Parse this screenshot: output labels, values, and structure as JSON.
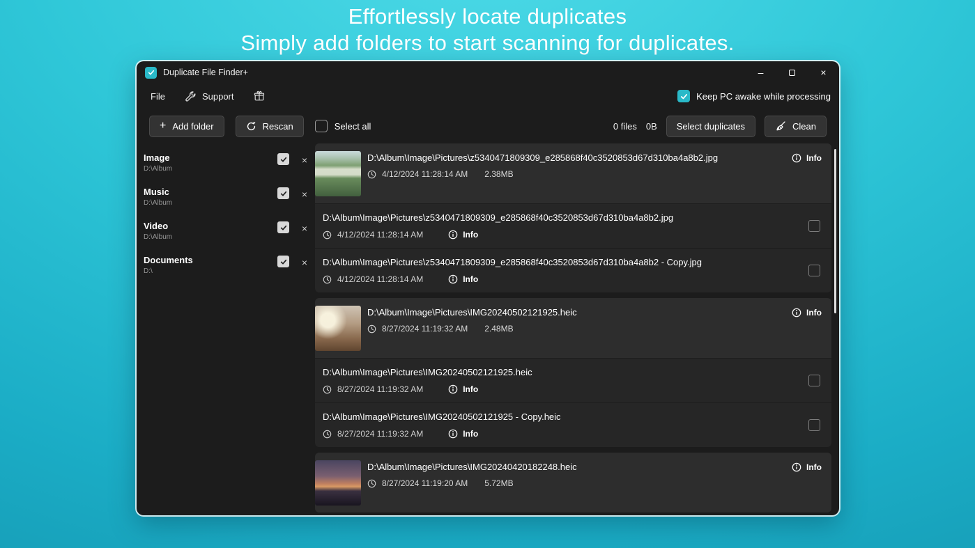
{
  "hero": {
    "title": "Effortlessly locate duplicates",
    "subtitle": "Simply add folders to start scanning for duplicates."
  },
  "icons": {
    "minimize": "–",
    "close": "×",
    "remove": "×",
    "plus": "+"
  },
  "colors": {
    "accent": "#2ab9c8",
    "window_bg": "#1c1c1c",
    "background_top": "#4fdbe8",
    "background_bottom": "#1496b0"
  },
  "window": {
    "title": "Duplicate File Finder+",
    "menu": {
      "file": "File",
      "support": "Support"
    },
    "keep_awake": {
      "label": "Keep PC awake while processing",
      "checked": true
    },
    "toolbar": {
      "add_folder": "Add folder",
      "rescan": "Rescan",
      "select_all": "Select all",
      "select_all_checked": false,
      "files_count": "0 files",
      "total_size": "0B",
      "select_duplicates": "Select duplicates",
      "clean": "Clean"
    },
    "sidebar": {
      "items": [
        {
          "name": "Image",
          "path": "D:\\Album",
          "checked": true
        },
        {
          "name": "Music",
          "path": "D:\\Album",
          "checked": true
        },
        {
          "name": "Video",
          "path": "D:\\Album",
          "checked": true
        },
        {
          "name": "Documents",
          "path": "D:\\",
          "checked": true
        }
      ]
    },
    "groups": [
      {
        "path": "D:\\Album\\Image\\Pictures\\z5340471809309_e285868f40c3520853d67d310ba4a8b2.jpg",
        "date": "4/12/2024 11:28:14 AM",
        "size": "2.38MB",
        "info_label": "Info",
        "children": [
          {
            "path": "D:\\Album\\Image\\Pictures\\z5340471809309_e285868f40c3520853d67d310ba4a8b2.jpg",
            "date": "4/12/2024 11:28:14 AM",
            "info_label": "Info",
            "checked": false
          },
          {
            "path": "D:\\Album\\Image\\Pictures\\z5340471809309_e285868f40c3520853d67d310ba4a8b2 - Copy.jpg",
            "date": "4/12/2024 11:28:14 AM",
            "info_label": "Info",
            "checked": false
          }
        ]
      },
      {
        "path": "D:\\Album\\Image\\Pictures\\IMG20240502121925.heic",
        "date": "8/27/2024 11:19:32 AM",
        "size": "2.48MB",
        "info_label": "Info",
        "children": [
          {
            "path": "D:\\Album\\Image\\Pictures\\IMG20240502121925.heic",
            "date": "8/27/2024 11:19:32 AM",
            "info_label": "Info",
            "checked": false
          },
          {
            "path": "D:\\Album\\Image\\Pictures\\IMG20240502121925 - Copy.heic",
            "date": "8/27/2024 11:19:32 AM",
            "info_label": "Info",
            "checked": false
          }
        ]
      },
      {
        "path": "D:\\Album\\Image\\Pictures\\IMG20240420182248.heic",
        "date": "8/27/2024 11:19:20 AM",
        "size": "5.72MB",
        "info_label": "Info",
        "children": []
      }
    ]
  }
}
